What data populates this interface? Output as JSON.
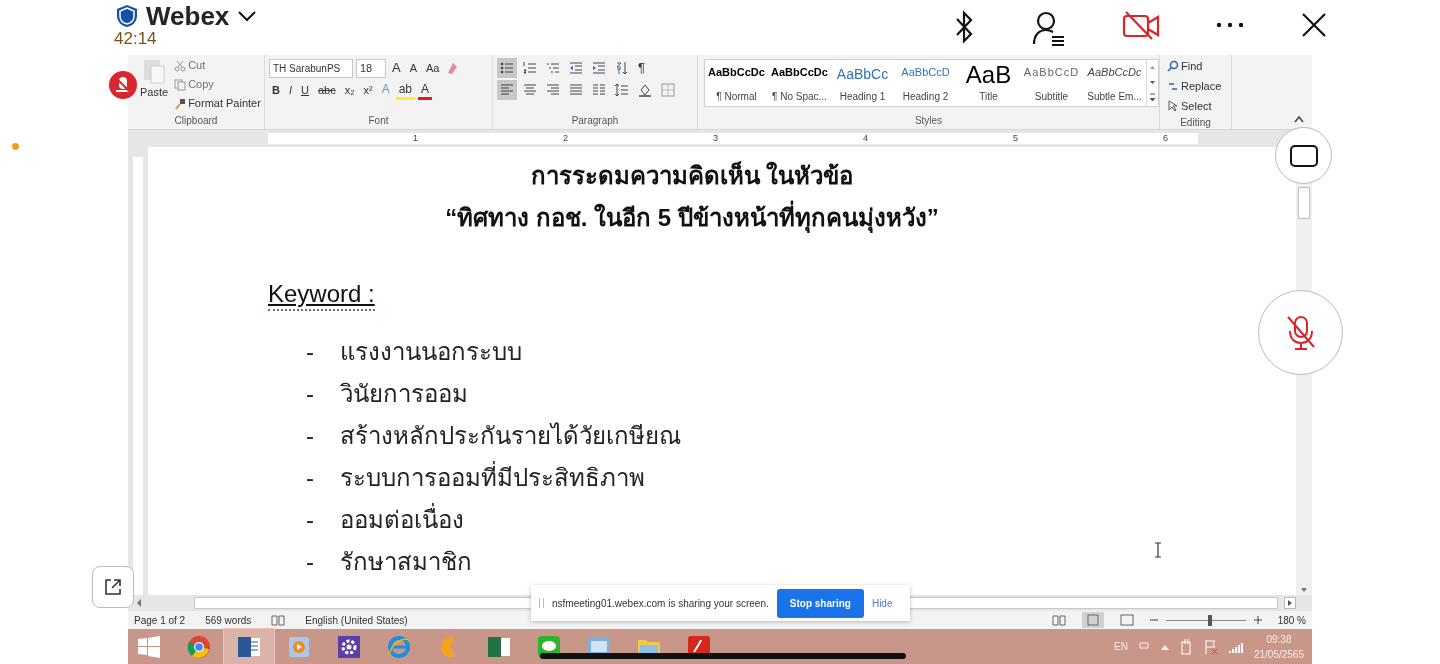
{
  "webex": {
    "title": "Webex",
    "timer": "42:14"
  },
  "ribbon": {
    "clipboard": {
      "paste": "Paste",
      "items": [
        "Cut",
        "Copy",
        "Format Painter"
      ],
      "label": "Clipboard"
    },
    "font": {
      "name": "TH SarabunPS",
      "size": "18",
      "size_buttons": [
        "A",
        "A"
      ],
      "case_button": "Aa",
      "format_buttons": [
        "B",
        "I",
        "U",
        "abc",
        "x₂",
        "x²"
      ],
      "color_buttons": [
        "A",
        "ab",
        "A"
      ],
      "label": "Font"
    },
    "paragraph": {
      "label": "Paragraph",
      "show_marks": "¶",
      "buttons": [
        {
          "kind": "bullets",
          "selected": true
        },
        {
          "kind": "numbering",
          "selected": false
        },
        {
          "kind": "multilevel",
          "selected": false
        },
        {
          "kind": "outdent",
          "selected": false
        },
        {
          "kind": "indent",
          "selected": false
        },
        {
          "kind": "sort",
          "selected": false
        },
        {
          "kind": "align-left",
          "selected": true
        },
        {
          "kind": "align-center",
          "selected": false
        },
        {
          "kind": "align-right",
          "selected": false
        },
        {
          "kind": "justify",
          "selected": false
        },
        {
          "kind": "columns",
          "selected": false
        },
        {
          "kind": "line-spacing",
          "selected": false
        },
        {
          "kind": "shading",
          "selected": false
        },
        {
          "kind": "borders",
          "selected": false
        }
      ]
    },
    "styles": {
      "label": "Styles",
      "items": [
        {
          "preview": "AaBbCcDc",
          "name": "¶ Normal",
          "kind": "normal"
        },
        {
          "preview": "AaBbCcDc",
          "name": "¶ No Spac...",
          "kind": "normal"
        },
        {
          "preview": "AaBbCc",
          "name": "Heading 1",
          "kind": "heading1"
        },
        {
          "preview": "AaBbCcD",
          "name": "Heading 2",
          "kind": "heading2"
        },
        {
          "preview": "AaB",
          "name": "Title",
          "kind": "title"
        },
        {
          "preview": "AaBbCcD",
          "name": "Subtitle",
          "kind": "subtitle"
        },
        {
          "preview": "AaBbCcDc",
          "name": "Subtle Em...",
          "kind": "emphasis"
        }
      ]
    },
    "editing": {
      "label": "Editing",
      "items": [
        "Find",
        "Replace",
        "Select"
      ]
    }
  },
  "ruler": {
    "numbers": [
      "1",
      "2",
      "3",
      "4",
      "5",
      "6"
    ]
  },
  "document": {
    "title_lines": [
      "การระดมความคิดเห็น ในหัวข้อ",
      "“ทิศทาง กอช. ในอีก 5 ปีข้างหน้าที่ทุกคนมุ่งหวัง”"
    ],
    "heading": "Keyword :",
    "items": [
      {
        "marker": "-",
        "text": "แรงงานนอกระบบ"
      },
      {
        "marker": "-",
        "text": "วินัยการออม"
      },
      {
        "marker": "-",
        "text": "สร้างหลักประกันรายได้วัยเกษียณ"
      },
      {
        "marker": "-",
        "text": "ระบบการออมที่มีประสิทธิภาพ"
      },
      {
        "marker": "-",
        "text": "ออมต่อเนื่อง"
      },
      {
        "marker": "-",
        "text": "รักษาสมาชิก"
      }
    ]
  },
  "share_banner": {
    "message": "nsfmeeting01.webex.com is sharing your screen.",
    "stop_button": "Stop sharing",
    "hide_link": "Hide"
  },
  "status_bar": {
    "page": "Page 1 of 2",
    "words": "569 words",
    "language": "English (United States)",
    "zoom": {
      "level": 0.56,
      "reading": "180 %"
    }
  },
  "taskbar": {
    "apps": [
      {
        "kind": "chrome",
        "selected": false
      },
      {
        "kind": "word",
        "selected": true
      },
      {
        "kind": "media",
        "selected": false
      },
      {
        "kind": "settings",
        "selected": false
      },
      {
        "kind": "ie",
        "selected": false
      },
      {
        "kind": "app",
        "selected": false
      },
      {
        "kind": "excel",
        "selected": false
      },
      {
        "kind": "line",
        "selected": false
      },
      {
        "kind": "screen",
        "selected": false
      },
      {
        "kind": "folder",
        "selected": false
      },
      {
        "kind": "acrobat",
        "selected": false
      }
    ],
    "language": "EN",
    "time": "09:38",
    "date": "21/05/2565"
  }
}
